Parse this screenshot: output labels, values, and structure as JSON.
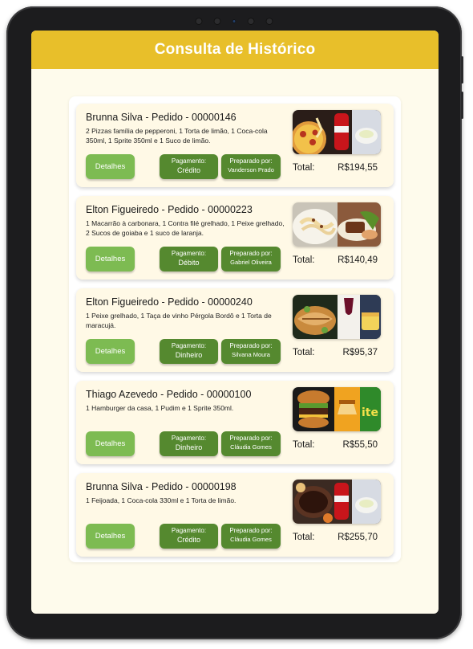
{
  "screen": {
    "title": "Consulta de Histórico"
  },
  "labels": {
    "details": "Detalhes",
    "payment": "Pagamento:",
    "prepared_by": "Preparado por:",
    "total": "Total:"
  },
  "orders": [
    {
      "title": "Brunna Silva -  Pedido - 00000146",
      "description": "2 Pizzas família de pepperoni, 1 Torta de limão, 1 Coca-cola 350ml, 1 Sprite 350ml e 1 Suco de limão.",
      "payment": "Crédito",
      "prepared_by": "Vanderson Prado",
      "total": "R$194,55",
      "image": "pizza-coca-cola-pie-photo"
    },
    {
      "title": "Elton Figueiredo - Pedido - 00000223",
      "description": "1 Macarrão à carbonara, 1 Contra filé grelhado,  1 Peixe grelhado, 2 Sucos de goiaba e 1 suco de laranja.",
      "payment": "Débito",
      "prepared_by": "Gabriel Oliveira",
      "total": "R$140,49",
      "image": "pasta-steak-fish-photo"
    },
    {
      "title": "Elton Figueiredo - Pedido - 00000240",
      "description": "1 Peixe grelhado, 1 Taça de vinho Pérgola Bordô e 1 Torta de maracujá.",
      "payment": "Dinheiro",
      "prepared_by": "Silvana Moura",
      "total": "R$95,37",
      "image": "fish-wine-pie-photo"
    },
    {
      "title": "Thiago Azevedo - Pedido - 00000100",
      "description": "1 Hamburger da casa, 1 Pudim e 1 Sprite 350ml.",
      "payment": "Dinheiro",
      "prepared_by": "Cláudia Gomes",
      "total": "R$55,50",
      "image": "burger-pudding-sprite-photo"
    },
    {
      "title": "Brunna Silva - Pedido - 00000198",
      "description": "1 Feijoada, 1 Coca-cola 330ml e 1 Torta de limão.",
      "payment": "Crédito",
      "prepared_by": "Cláudia Gomes",
      "total": "R$255,70",
      "image": "feijoada-coca-cola-pie-photo"
    }
  ],
  "colors": {
    "header": "#e8bf2a",
    "background": "#fefbec",
    "card": "#fff9e6",
    "details_button": "#7dbb52",
    "info_button": "#55892f"
  }
}
